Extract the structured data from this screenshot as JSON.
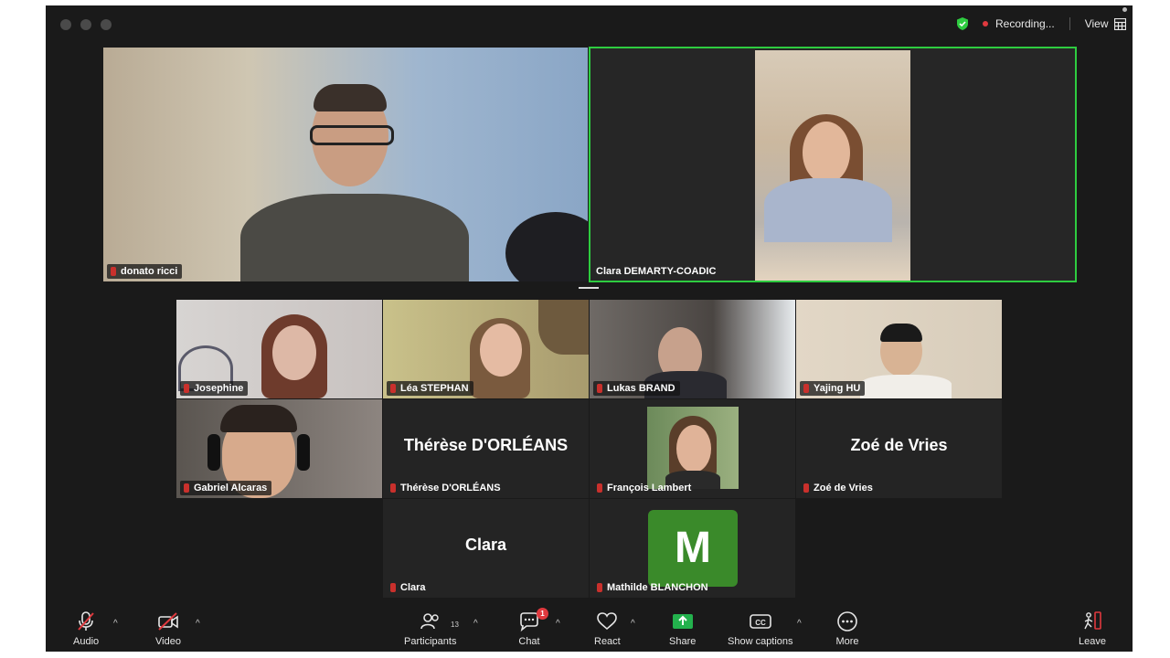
{
  "titlebar": {
    "recording_label": "Recording...",
    "view_label": "View"
  },
  "speakers": [
    {
      "name": "donato ricci"
    },
    {
      "name": "Clara DEMARTY-COADIC"
    }
  ],
  "gallery": [
    {
      "name": "Josephine"
    },
    {
      "name": "Léa STEPHAN"
    },
    {
      "name": "Lukas BRAND"
    },
    {
      "name": "Yajing HU"
    },
    {
      "name": "Gabriel Alcaras"
    },
    {
      "name": "Thérèse D'ORLÉANS",
      "display": "Thérèse D'ORLÉANS"
    },
    {
      "name": "François Lambert"
    },
    {
      "name": "Zoé de Vries",
      "display": "Zoé de Vries"
    },
    {
      "name": "Clara",
      "display": "Clara"
    },
    {
      "name": "Mathilde BLANCHON",
      "avatar_letter": "M"
    }
  ],
  "toolbar": {
    "audio": "Audio",
    "video": "Video",
    "participants": "Participants",
    "participants_count": "13",
    "chat": "Chat",
    "chat_badge": "1",
    "react": "React",
    "share": "Share",
    "captions": "Show captions",
    "more": "More",
    "leave": "Leave"
  },
  "colors": {
    "active_speaker_border": "#2ecc40",
    "share_green": "#23b14d",
    "avatar_green": "#3a8a2a",
    "mute_red": "#e0393e"
  }
}
